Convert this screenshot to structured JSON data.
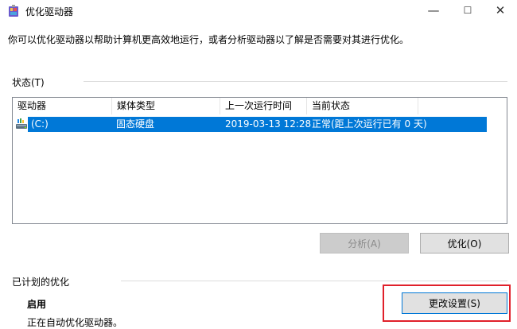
{
  "window": {
    "title": "优化驱动器",
    "minimize_glyph": "—",
    "maximize_glyph": "☐",
    "close_glyph": "✕"
  },
  "description": "你可以优化驱动器以帮助计算机更高效地运行，或者分析驱动器以了解是否需要对其进行优化。",
  "status_section": {
    "label": "状态(T)",
    "columns": [
      "驱动器",
      "媒体类型",
      "上一次运行时间",
      "当前状态"
    ],
    "rows": [
      {
        "drive": "(C:)",
        "media": "固态硬盘",
        "last_run": "2019-03-13 12:28",
        "status": "正常(距上次运行已有 0 天)",
        "selected": true
      }
    ]
  },
  "buttons": {
    "analyze": "分析(A)",
    "optimize": "优化(O)",
    "change_settings": "更改设置(S)"
  },
  "scheduled": {
    "label": "已计划的优化",
    "state": "启用",
    "detail": "正在自动优化驱动器。"
  },
  "colors": {
    "selection": "#0078d7",
    "highlight_box": "#e0202a"
  }
}
